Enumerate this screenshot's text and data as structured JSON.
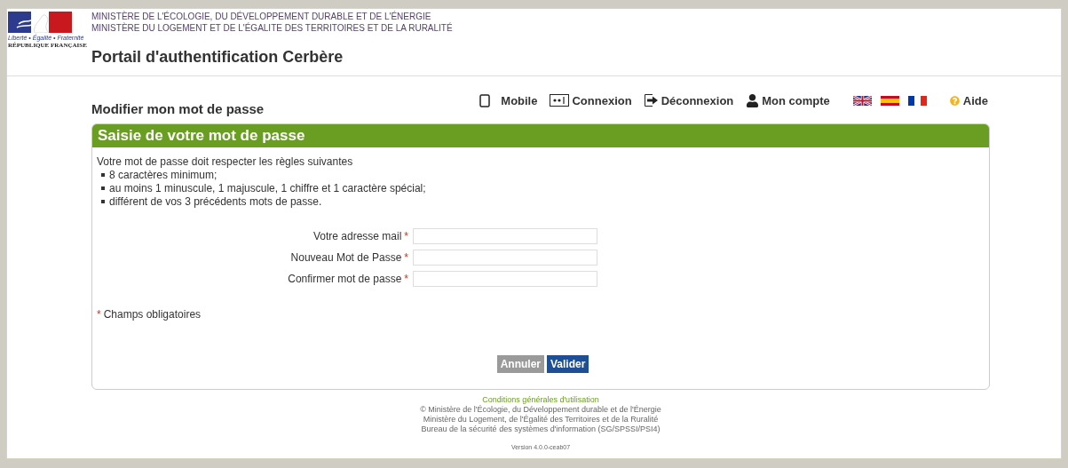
{
  "header": {
    "logo_motto": "Liberté • Égalité • Fraternité",
    "logo_country": "RÉPUBLIQUE FRANÇAISE",
    "ministries": [
      "MINISTÈRE DE L'ÉCOLOGIE, DU DÉVELOPPEMENT DURABLE ET DE L'ÉNERGIE",
      "MINISTÈRE DU LOGEMENT ET DE L'ÉGALITE DES TERRITOIRES ET DE LA RURALITÉ"
    ],
    "title": "Portail d'authentification Cerbère"
  },
  "nav": [
    {
      "kind": "mobile",
      "label": "Mobile"
    },
    {
      "kind": "login",
      "label": "Connexion"
    },
    {
      "kind": "logout",
      "label": "Déconnexion"
    },
    {
      "kind": "account",
      "label": "Mon compte"
    }
  ],
  "languages": [
    {
      "kind": "en"
    },
    {
      "kind": "es"
    },
    {
      "kind": "fr"
    }
  ],
  "help": "Aide",
  "page_title": "Modifier mon mot de passe",
  "panel": {
    "title": "Saisie de votre mot de passe",
    "rules_intro": "Votre mot de passe doit respecter les règles suivantes",
    "rules": [
      "8 caractères minimum;",
      "au moins 1 minuscule, 1 majuscule, 1 chiffre et 1 caractère spécial;",
      "différent de vos 3 précédents mots de passe."
    ],
    "fields": [
      {
        "label": "Votre adresse mail",
        "required_mark": "*"
      },
      {
        "label": "Nouveau Mot de Passe",
        "required_mark": "*"
      },
      {
        "label": "Confirmer mot de passe",
        "required_mark": "*"
      }
    ],
    "required_note_mark": "*",
    "required_note": "Champs obligatoires",
    "buttons": [
      {
        "kind": "secondary",
        "label": "Annuler"
      },
      {
        "kind": "primary",
        "label": "Valider"
      }
    ]
  },
  "footer": {
    "link": "Conditions générales d'utilisation",
    "lines": [
      "© Ministère de l'Écologie, du Développement durable et de l'Énergie",
      "Ministère du Logement, de l'Égalité des Territoires et de la Ruralité",
      "Bureau de la sécurité des systèmes d'information (SG/SPSSI/PSI4)"
    ],
    "version": "Version 4.0.0-ceab07"
  }
}
